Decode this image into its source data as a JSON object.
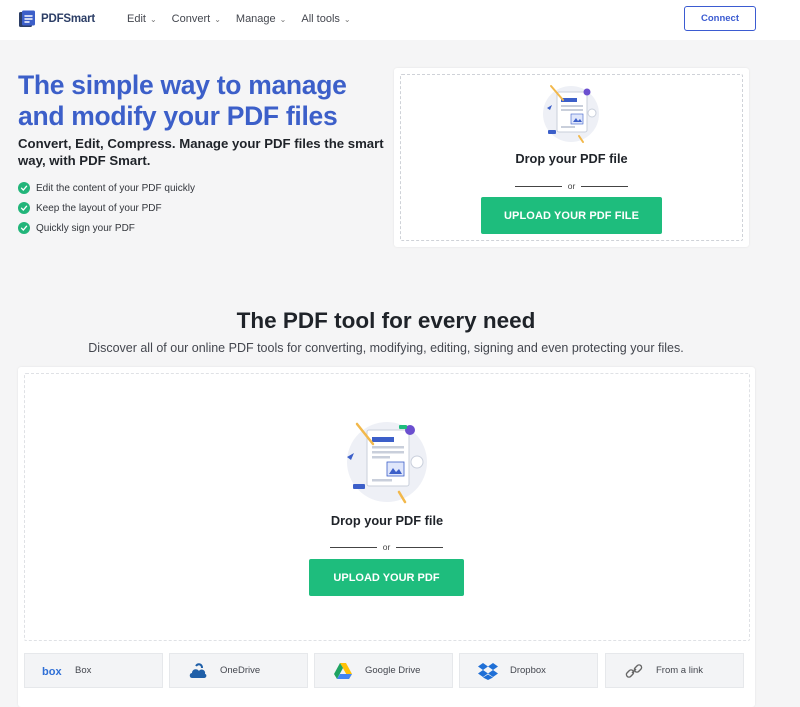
{
  "header": {
    "logo_text": "PDFSmart",
    "nav": [
      {
        "label": "Edit"
      },
      {
        "label": "Convert"
      },
      {
        "label": "Manage"
      },
      {
        "label": "All tools"
      }
    ],
    "connect_label": "Connect"
  },
  "hero": {
    "title": "The simple way to manage and modify your PDF files",
    "subtitle": "Convert, Edit, Compress. Manage your PDF files the smart way, with PDF Smart.",
    "features": [
      "Edit the content of your PDF quickly",
      "Keep the layout of your PDF",
      "Quickly sign your PDF"
    ],
    "drop_label": "Drop your PDF file",
    "or_text": "or",
    "upload_label": "UPLOAD YOUR PDF FILE"
  },
  "tools": {
    "title": "The PDF tool for every need",
    "description": "Discover all of our online PDF tools for converting, modifying, editing, signing and even protecting your files.",
    "drop_label": "Drop your PDF file",
    "or_text": "or",
    "upload_label": "UPLOAD YOUR PDF",
    "sources": [
      {
        "label": "Box",
        "icon": "box-icon"
      },
      {
        "label": "OneDrive",
        "icon": "onedrive-icon"
      },
      {
        "label": "Google Drive",
        "icon": "google-drive-icon"
      },
      {
        "label": "Dropbox",
        "icon": "dropbox-icon"
      },
      {
        "label": "From a link",
        "icon": "link-icon"
      }
    ]
  },
  "colors": {
    "brand_blue": "#3c5fc9",
    "accent_green": "#1ebd7d",
    "check_green": "#22b57a"
  }
}
